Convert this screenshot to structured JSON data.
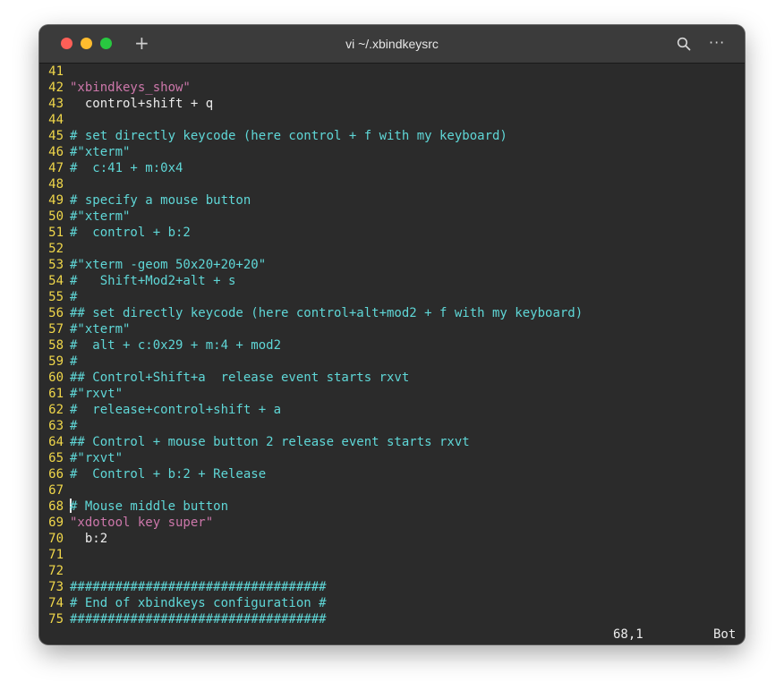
{
  "window": {
    "title": "vi ~/.xbindkeysrc",
    "new_tab_label": "+",
    "search_icon": "search-icon",
    "more_icon": "more-icon",
    "more_glyph": "···"
  },
  "colors": {
    "background": "#2b2b2b",
    "line_number": "#f0d74a",
    "comment": "#5fd7d7",
    "string": "#cc77aa",
    "text": "#ececec"
  },
  "editor": {
    "lines": [
      {
        "n": "41",
        "text": "",
        "type": "text"
      },
      {
        "n": "42",
        "text": "\"xbindkeys_show\"",
        "type": "string"
      },
      {
        "n": "43",
        "text": "  control+shift + q",
        "type": "text"
      },
      {
        "n": "44",
        "text": "",
        "type": "text"
      },
      {
        "n": "45",
        "text": "# set directly keycode (here control + f with my keyboard)",
        "type": "comment"
      },
      {
        "n": "46",
        "text": "#\"xterm\"",
        "type": "comment"
      },
      {
        "n": "47",
        "text": "#  c:41 + m:0x4",
        "type": "comment"
      },
      {
        "n": "48",
        "text": "",
        "type": "text"
      },
      {
        "n": "49",
        "text": "# specify a mouse button",
        "type": "comment"
      },
      {
        "n": "50",
        "text": "#\"xterm\"",
        "type": "comment"
      },
      {
        "n": "51",
        "text": "#  control + b:2",
        "type": "comment"
      },
      {
        "n": "52",
        "text": "",
        "type": "text"
      },
      {
        "n": "53",
        "text": "#\"xterm -geom 50x20+20+20\"",
        "type": "comment"
      },
      {
        "n": "54",
        "text": "#   Shift+Mod2+alt + s",
        "type": "comment"
      },
      {
        "n": "55",
        "text": "#",
        "type": "comment"
      },
      {
        "n": "56",
        "text": "## set directly keycode (here control+alt+mod2 + f with my keyboard)",
        "type": "comment"
      },
      {
        "n": "57",
        "text": "#\"xterm\"",
        "type": "comment"
      },
      {
        "n": "58",
        "text": "#  alt + c:0x29 + m:4 + mod2",
        "type": "comment"
      },
      {
        "n": "59",
        "text": "#",
        "type": "comment"
      },
      {
        "n": "60",
        "text": "## Control+Shift+a  release event starts rxvt",
        "type": "comment"
      },
      {
        "n": "61",
        "text": "#\"rxvt\"",
        "type": "comment"
      },
      {
        "n": "62",
        "text": "#  release+control+shift + a",
        "type": "comment"
      },
      {
        "n": "63",
        "text": "#",
        "type": "comment"
      },
      {
        "n": "64",
        "text": "## Control + mouse button 2 release event starts rxvt",
        "type": "comment"
      },
      {
        "n": "65",
        "text": "#\"rxvt\"",
        "type": "comment"
      },
      {
        "n": "66",
        "text": "#  Control + b:2 + Release",
        "type": "comment"
      },
      {
        "n": "67",
        "text": "",
        "type": "text"
      },
      {
        "n": "68",
        "text": "# Mouse middle button",
        "type": "comment",
        "cursor": true
      },
      {
        "n": "69",
        "text": "\"xdotool key super\"",
        "type": "string"
      },
      {
        "n": "70",
        "text": "  b:2",
        "type": "text"
      },
      {
        "n": "71",
        "text": "",
        "type": "text"
      },
      {
        "n": "72",
        "text": "",
        "type": "text"
      },
      {
        "n": "73",
        "text": "##################################",
        "type": "comment"
      },
      {
        "n": "74",
        "text": "# End of xbindkeys configuration #",
        "type": "comment"
      },
      {
        "n": "75",
        "text": "##################################",
        "type": "comment"
      }
    ]
  },
  "status": {
    "position": "68,1",
    "scroll": "Bot"
  }
}
